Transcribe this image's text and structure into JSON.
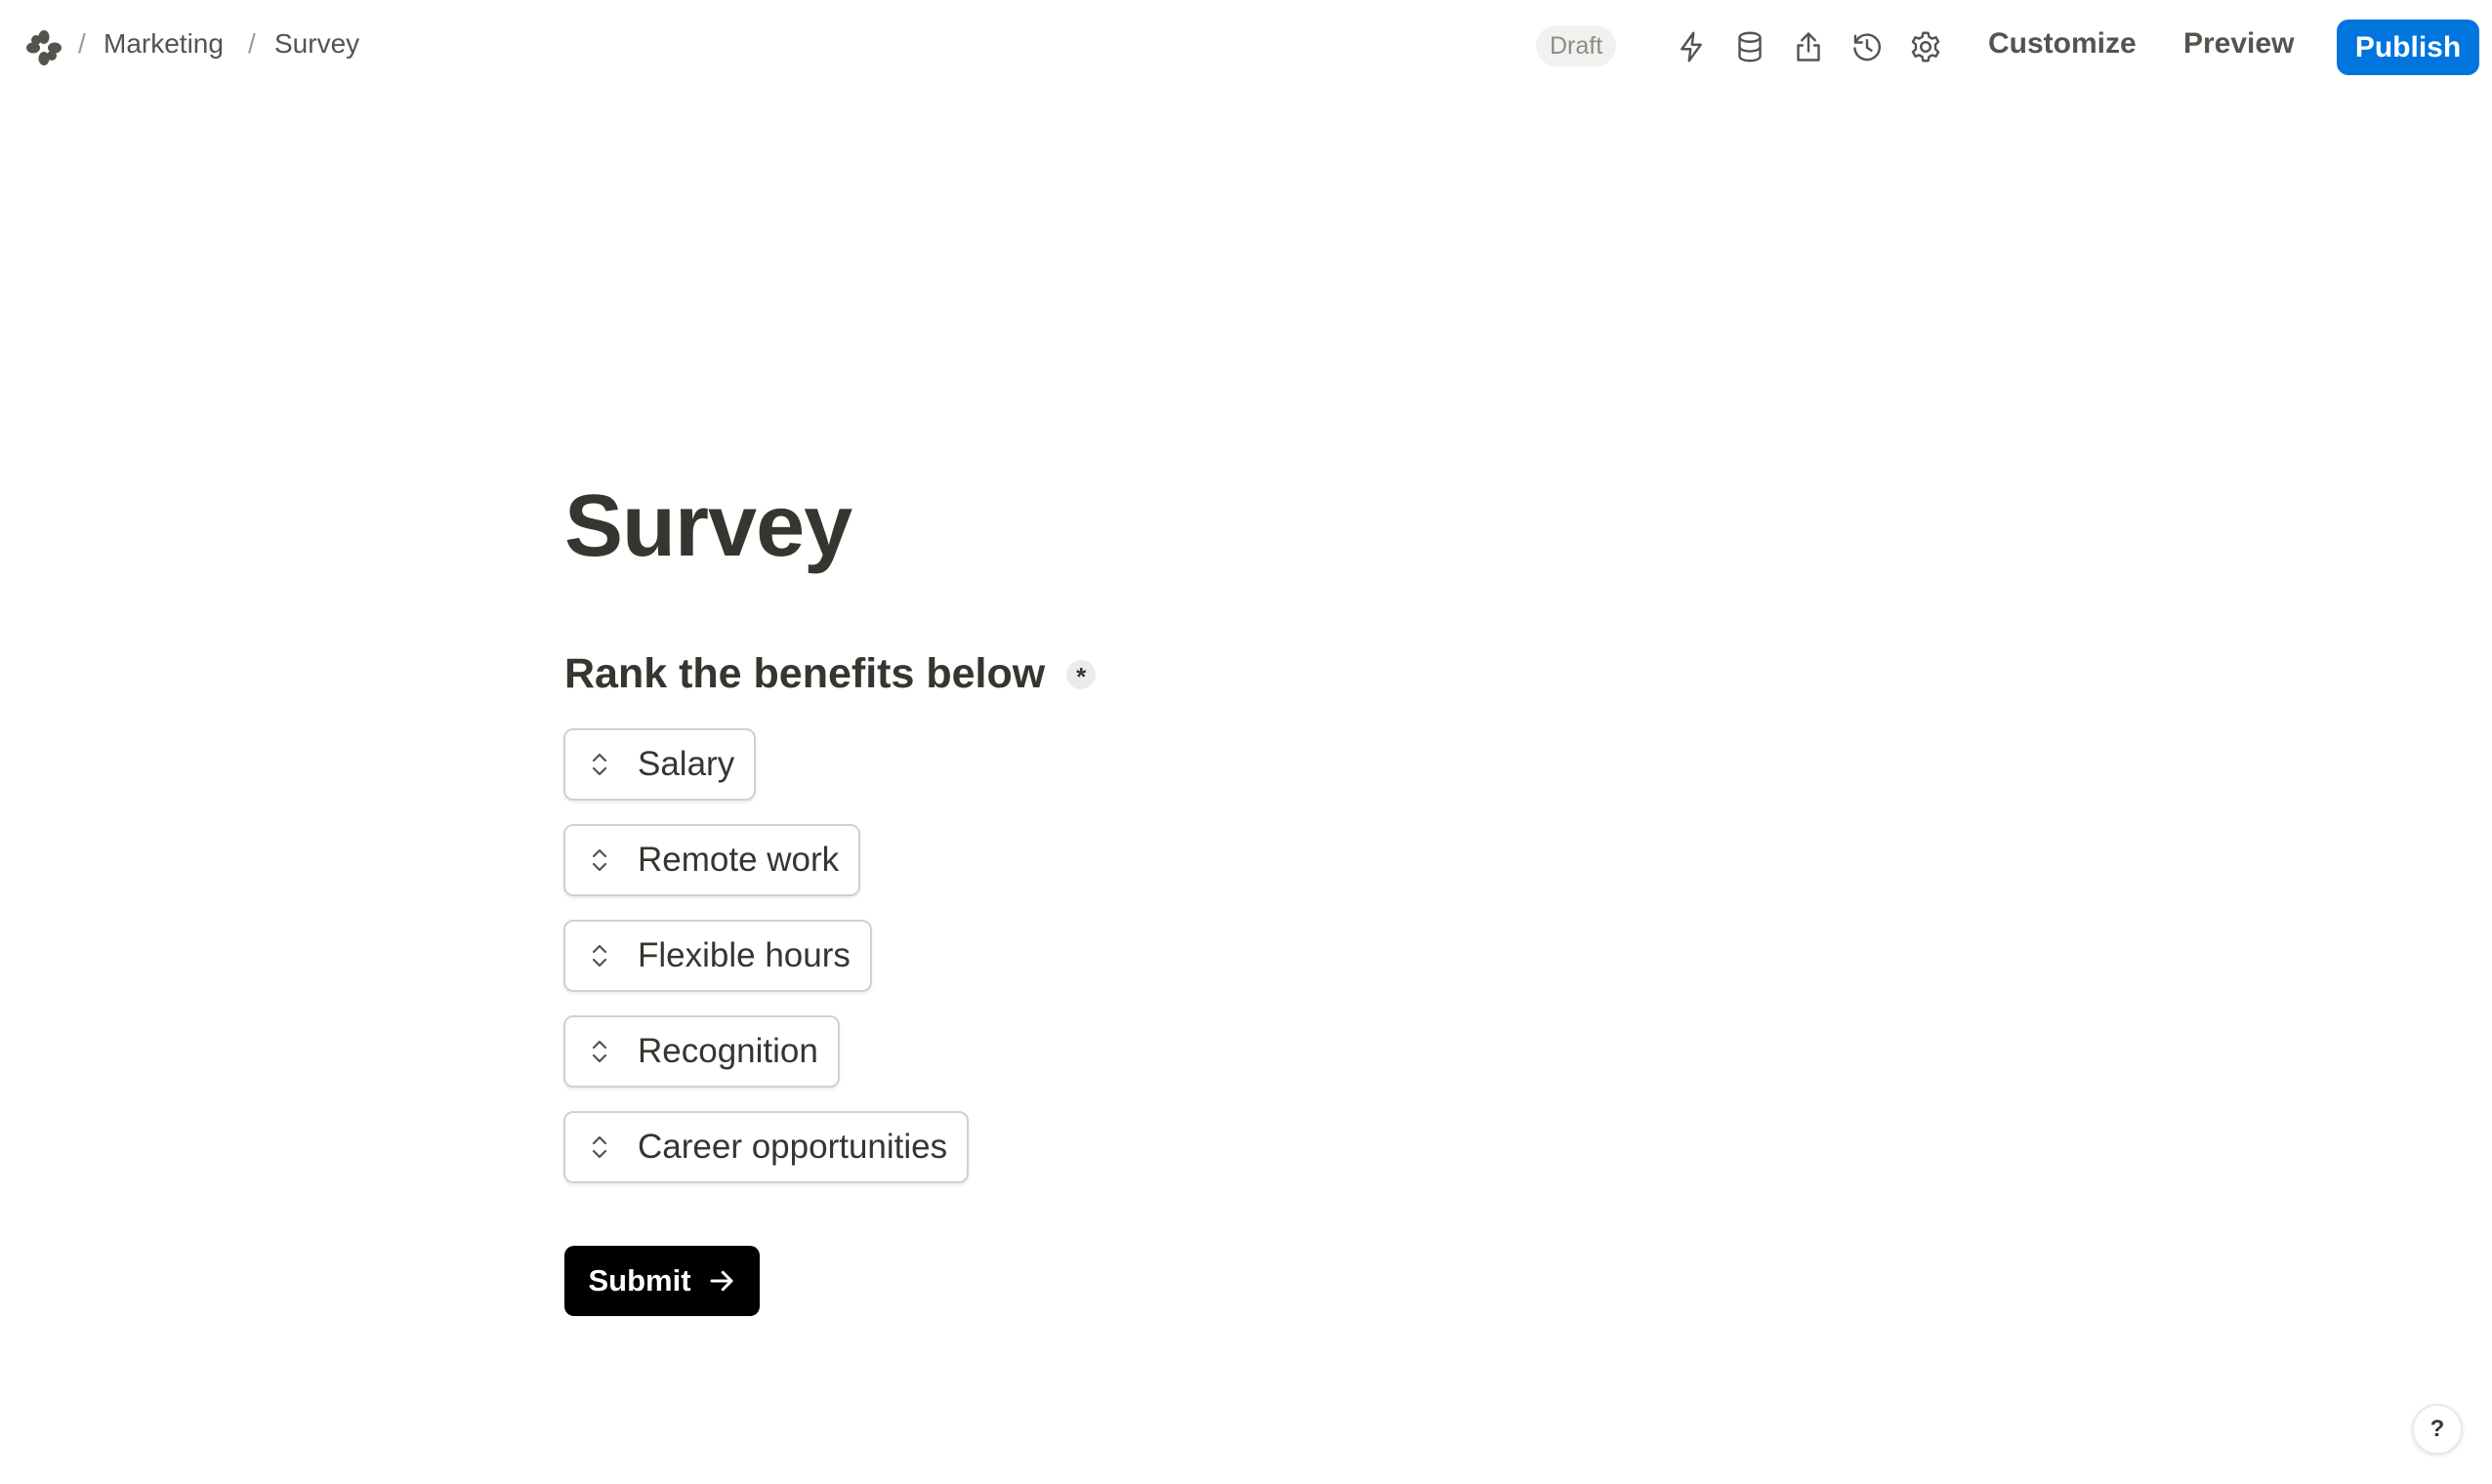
{
  "header": {
    "logo_icon": "flower-icon",
    "breadcrumb": [
      "Marketing",
      "Survey"
    ],
    "separator": "/",
    "status_badge": "Draft",
    "icons": [
      "lightning-icon",
      "database-icon",
      "share-icon",
      "history-icon",
      "settings-icon"
    ],
    "customize_label": "Customize",
    "preview_label": "Preview",
    "publish_label": "Publish",
    "publish_color": "#0075de"
  },
  "form": {
    "title": "Survey",
    "question": "Rank the benefits below",
    "required_marker": "*",
    "rank_items": [
      "Salary",
      "Remote work",
      "Flexible hours",
      "Recognition",
      "Career opportunities"
    ],
    "submit_label": "Submit"
  },
  "help": {
    "label": "?"
  }
}
